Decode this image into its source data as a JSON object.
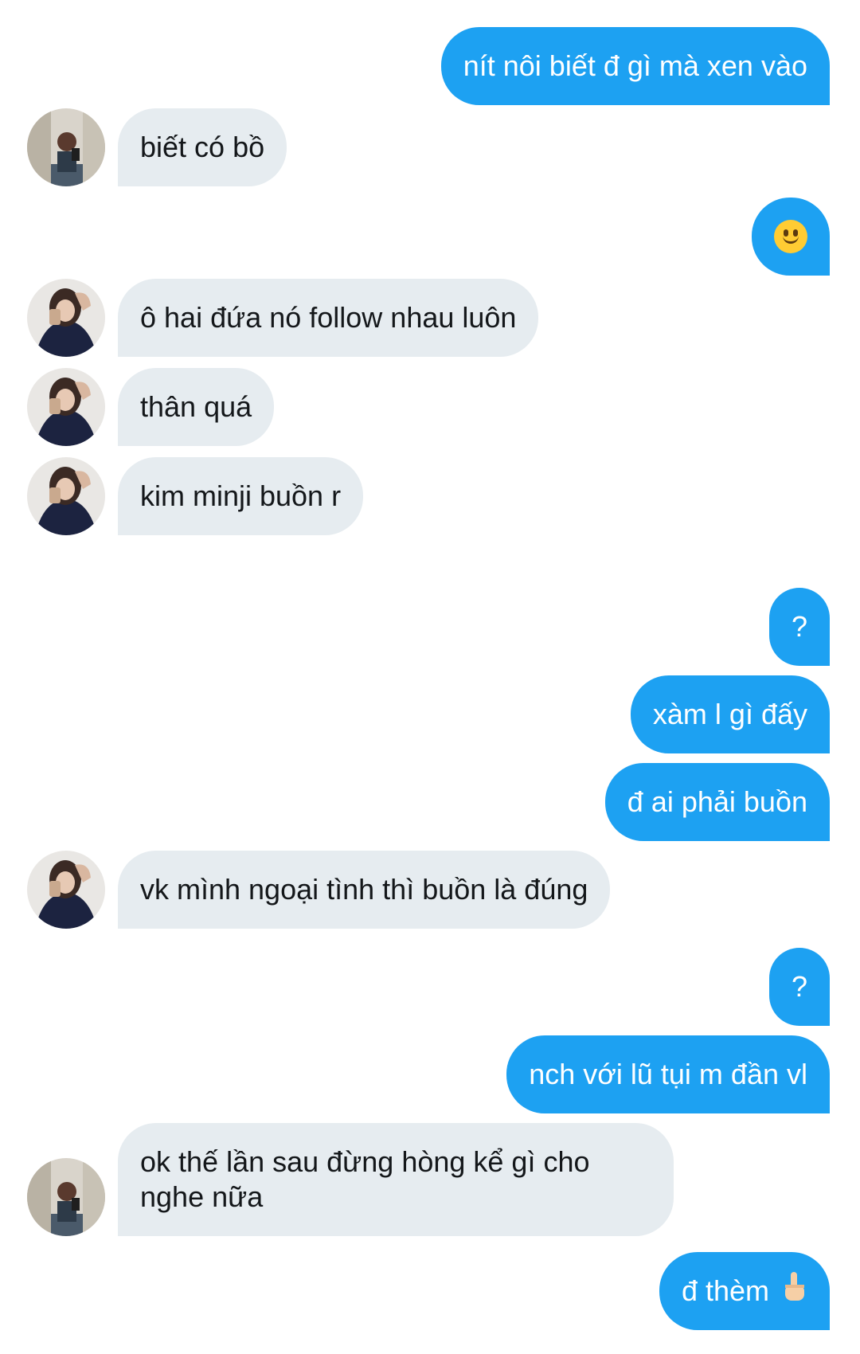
{
  "conversation": {
    "messages": [
      {
        "direction": "outgoing",
        "text": "nít nôi biết đ gì mà xen vào"
      },
      {
        "direction": "incoming",
        "avatar": "avatar-mirror-selfie",
        "text": "biết có bồ"
      },
      {
        "direction": "outgoing",
        "emoji": "slightly-smiling-face-icon"
      },
      {
        "direction": "incoming",
        "avatar": "avatar-hand-on-head",
        "text": "ô hai đứa nó follow nhau luôn"
      },
      {
        "direction": "incoming",
        "avatar": "avatar-hand-on-head",
        "text": "thân quá"
      },
      {
        "direction": "incoming",
        "avatar": "avatar-hand-on-head",
        "text": "kim minji buồn r"
      },
      {
        "direction": "outgoing",
        "text": "?"
      },
      {
        "direction": "outgoing",
        "text": "xàm l gì đấy"
      },
      {
        "direction": "outgoing",
        "text": "đ ai phải buồn"
      },
      {
        "direction": "incoming",
        "avatar": "avatar-hand-on-head",
        "text": "vk mình ngoại tình thì buồn là đúng"
      },
      {
        "direction": "outgoing",
        "text": "?"
      },
      {
        "direction": "outgoing",
        "text": "nch với lũ tụi m đần vl"
      },
      {
        "direction": "incoming",
        "avatar": "avatar-mirror-selfie",
        "text": "ok thế lần sau đừng hòng kể gì cho nghe nữa"
      },
      {
        "direction": "outgoing",
        "text": "đ thèm",
        "emoji": "hand-pointing-up-icon"
      }
    ]
  },
  "colors": {
    "outgoing_bubble": "#1da1f2",
    "incoming_bubble": "#e6ecf0",
    "outgoing_text": "#ffffff",
    "incoming_text": "#14171a",
    "background": "#ffffff"
  }
}
